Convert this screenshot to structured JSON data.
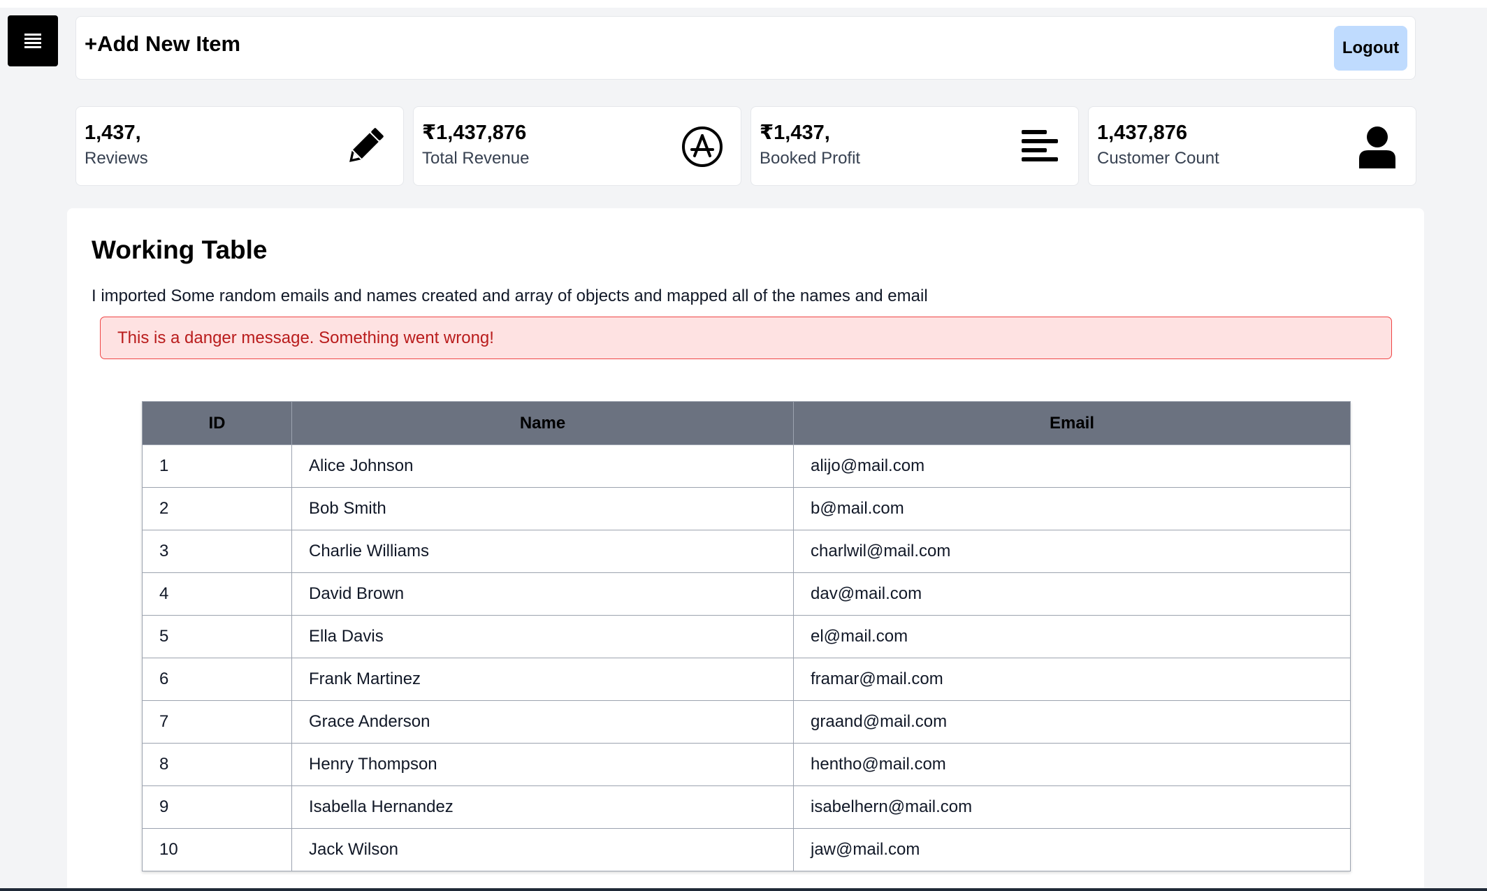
{
  "header": {
    "add_item_label": "+Add New Item",
    "logout_label": "Logout"
  },
  "menu": {
    "icon": "hamburger-menu-icon"
  },
  "stats": [
    {
      "value": "1,437,",
      "label": "Reviews",
      "icon": "pencil-icon"
    },
    {
      "value": "₹1,437,876",
      "label": "Total Revenue",
      "icon": "app-store-icon"
    },
    {
      "value": "₹1,437,",
      "label": "Booked Profit",
      "icon": "align-left-icon"
    },
    {
      "value": "1,437,876",
      "label": "Customer Count",
      "icon": "user-icon"
    }
  ],
  "panel": {
    "title": "Working Table",
    "description": "I imported Some random emails and names created and array of objects and mapped all of the names and email",
    "alert": "This is a danger message. Something went wrong!"
  },
  "table": {
    "headers": [
      "ID",
      "Name",
      "Email"
    ],
    "rows": [
      [
        "1",
        "Alice Johnson",
        "alijo@mail.com"
      ],
      [
        "2",
        "Bob Smith",
        "b@mail.com"
      ],
      [
        "3",
        "Charlie Williams",
        "charlwil@mail.com"
      ],
      [
        "4",
        "David Brown",
        "dav@mail.com"
      ],
      [
        "5",
        "Ella Davis",
        "el@mail.com"
      ],
      [
        "6",
        "Frank Martinez",
        "framar@mail.com"
      ],
      [
        "7",
        "Grace Anderson",
        "graand@mail.com"
      ],
      [
        "8",
        "Henry Thompson",
        "hentho@mail.com"
      ],
      [
        "9",
        "Isabella Hernandez",
        "isabelhern@mail.com"
      ],
      [
        "10",
        "Jack Wilson",
        "jaw@mail.com"
      ]
    ]
  },
  "colors": {
    "page_background": "#f3f4f6",
    "menu_button": "#000000",
    "logout_button": "#bfdbfe",
    "table_header": "#6b7280",
    "alert_background": "#fee2e2",
    "alert_border": "#ef4444",
    "alert_text": "#b91c1c"
  }
}
